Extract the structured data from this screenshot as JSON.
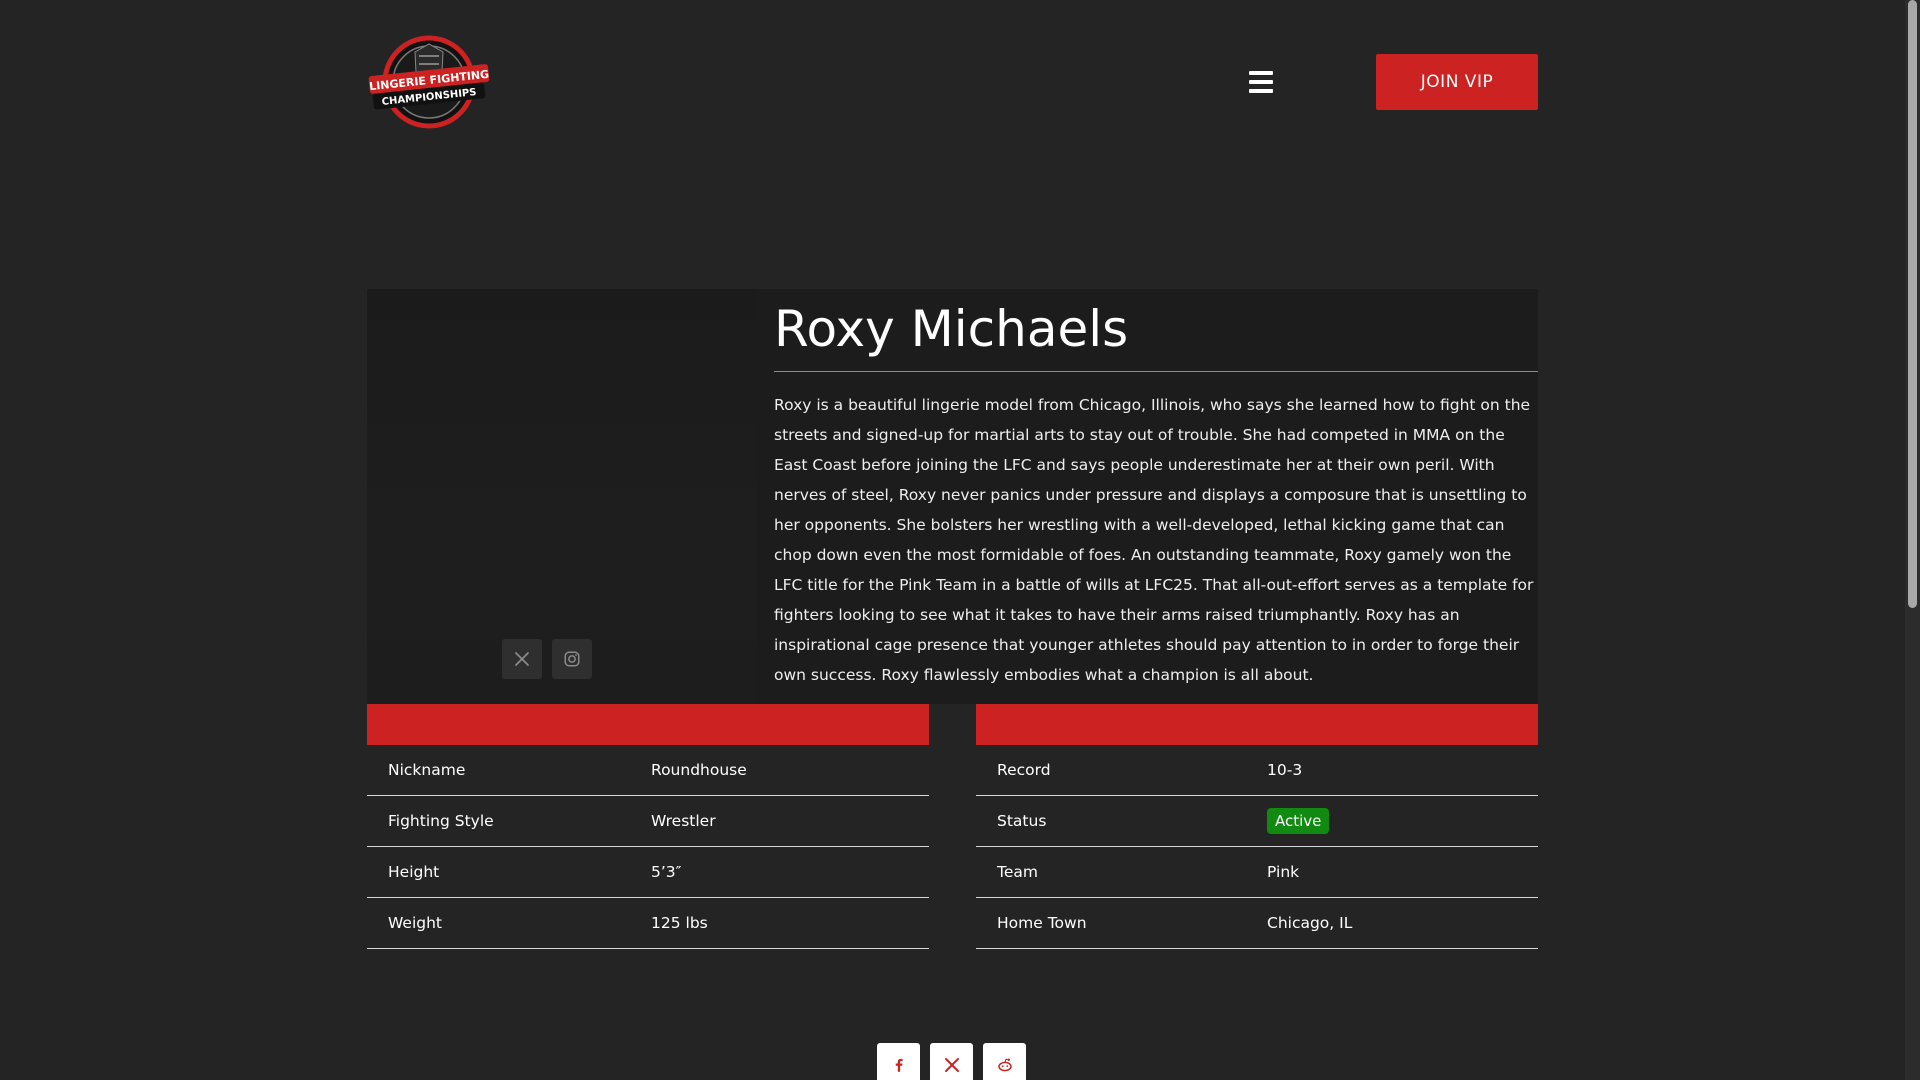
{
  "header": {
    "logo_text_line1": "LINGERIE FIGHTING",
    "logo_text_line2": "CHAMPIONSHIPS",
    "join_button": "JOIN VIP",
    "menu_icon": "hamburger-menu-icon"
  },
  "fighter": {
    "name": "Roxy Michaels",
    "bio": "Roxy is a beautiful lingerie model from Chicago, Illinois, who says she learned how to fight on the streets and signed-up for martial arts to stay out of trouble. She had competed in MMA on the East Coast before joining the LFC and says people underestimate her at their own peril. With nerves of steel, Roxy never panics under pressure and displays a composure that is unsettling to her opponents. She bolsters her wrestling with a well-developed, lethal kicking game that can chop down even the most formidable of foes. An outstanding teammate, Roxy gamely won the LFC title for the Pink Team in a battle of wills at LFC25. That all-out-effort serves as a template for fighters looking to see what it takes to have their arms raised triumphantly. Roxy has an inspirational cage presence that younger athletes should pay attention to in order to forge their own success. Roxy flawlessly embodies what a champion is all about.",
    "social_icons": [
      "x-icon",
      "instagram-icon"
    ]
  },
  "stats_left": [
    {
      "label": "Nickname",
      "value": "Roundhouse"
    },
    {
      "label": "Fighting Style",
      "value": "Wrestler"
    },
    {
      "label": "Height",
      "value": "5’3″"
    },
    {
      "label": "Weight",
      "value": "125 lbs"
    }
  ],
  "stats_right": [
    {
      "label": "Record",
      "value": "10-3"
    },
    {
      "label": "Status",
      "value": "Active"
    },
    {
      "label": "Team",
      "value": "Pink"
    },
    {
      "label": "Home Town",
      "value": "Chicago, IL"
    }
  ],
  "share": {
    "icons": [
      "facebook-icon",
      "x-icon",
      "reddit-icon"
    ]
  },
  "colors": {
    "background": "#242424",
    "panel": "#1c1c1c",
    "accent_red": "#cc2222",
    "status_green": "#108a10"
  }
}
